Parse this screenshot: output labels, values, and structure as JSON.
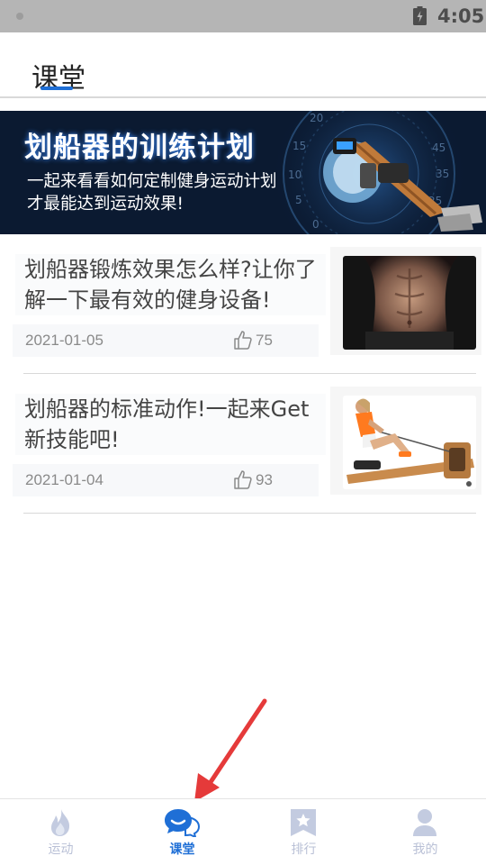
{
  "status_bar": {
    "time": "4:05"
  },
  "header": {
    "title": "课堂"
  },
  "banner": {
    "title": "划船器的训练计划",
    "line1": "一起来看看如何定制健身运动计划",
    "line2": "才最能达到运动效果!",
    "dial_numbers": [
      "20",
      "15",
      "10",
      "5",
      "0",
      "45",
      "35",
      "25"
    ]
  },
  "articles": [
    {
      "title": "划船器锻炼效果怎么样?让你了解一下最有效的健身设备!",
      "date": "2021-01-05",
      "likes": "75"
    },
    {
      "title": "划船器的标准动作!一起来Get新技能吧!",
      "date": "2021-01-04",
      "likes": "93"
    }
  ],
  "tabbar": {
    "tabs": [
      {
        "label": "运动",
        "icon": "flame-icon"
      },
      {
        "label": "课堂",
        "icon": "chat-bubble-icon",
        "active": true
      },
      {
        "label": "排行",
        "icon": "bookmark-star-icon"
      },
      {
        "label": "我的",
        "icon": "person-icon"
      }
    ]
  },
  "colors": {
    "accent": "#1f6fd6",
    "inactive_tab": "#b9c0d6",
    "banner_bg": "#0b1a31",
    "annotation_arrow": "#e53a3a"
  }
}
